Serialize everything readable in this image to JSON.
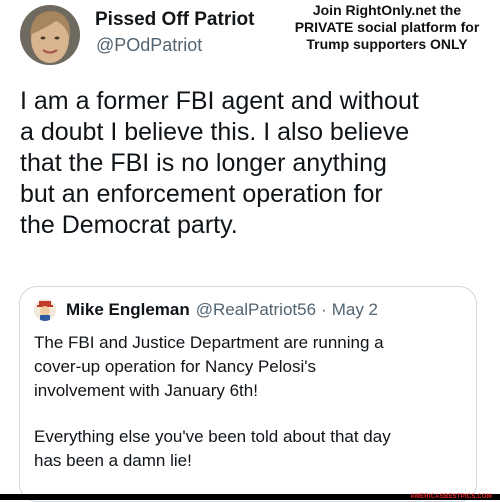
{
  "author": {
    "name": "Pissed Off Patriot",
    "handle": "@POdPatriot",
    "avatar_icon": "profile-photo"
  },
  "promo": {
    "lines": [
      "Join RightOnly.net the",
      "PRIVATE social platform for",
      "Trump supporters ONLY"
    ]
  },
  "tweet": {
    "lines": [
      "I am a former FBI agent and without",
      "a doubt I believe this. I also believe",
      "that the FBI is no longer anything",
      "but an enforcement operation for",
      "the Democrat party."
    ]
  },
  "quote": {
    "name": "Mike Engleman",
    "handle": "@RealPatriot56",
    "separator": "·",
    "date": "May 2",
    "avatar_icon": "profile-cartoon",
    "lines": [
      "The FBI and Justice Department are running a",
      "cover-up operation for Nancy Pelosi's",
      "involvement with January 6th!"
    ],
    "lines2": [
      "Everything else you've been told about that day",
      "has been a damn lie!"
    ]
  },
  "watermark": {
    "text": "AMERICASBESTPICS.COM"
  },
  "colors": {
    "handle_gray": "#536471",
    "border": "#cfd9de",
    "watermark_red": "#e8252b"
  }
}
